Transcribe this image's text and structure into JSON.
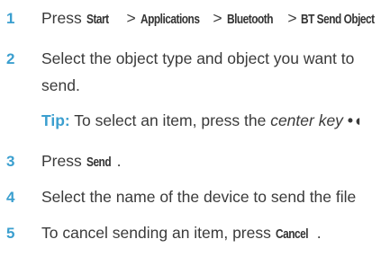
{
  "colors": {
    "step_number": "#3b9fcf",
    "body_text": "#3a3a3a",
    "tip_label": "#3b9fcf"
  },
  "steps": [
    {
      "number": "1",
      "prefix": "Press ",
      "path": [
        "Start",
        "Applications",
        "Bluetooth",
        "BT Send Object"
      ],
      "separator": " > ",
      "suffix": "."
    },
    {
      "number": "2",
      "line1": "Select the object type and object you want to",
      "line2": "send."
    },
    {
      "tip_label": "Tip:",
      "tip_text": " To select an item, press the ",
      "tip_em": "center key",
      "tip_icon": "center-key-icon",
      "tip_glyph": "•◖"
    },
    {
      "number": "3",
      "prefix": "Press ",
      "key": "Send",
      "suffix": "."
    },
    {
      "number": "4",
      "text": "Select the name of the device to send the file"
    },
    {
      "number": "5",
      "prefix": "To cancel sending an item, press ",
      "key": "Cancel",
      "suffix": "."
    }
  ]
}
